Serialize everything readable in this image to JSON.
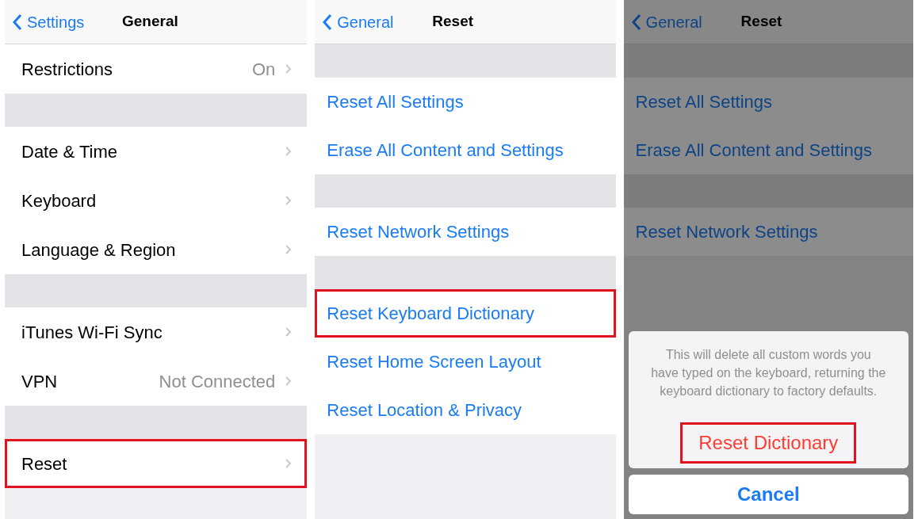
{
  "panels": [
    {
      "nav": {
        "back": "Settings",
        "title": "General"
      },
      "dimmed": false,
      "rows": [
        {
          "kind": "row",
          "label": "Restrictions",
          "value": "On",
          "chevron": true,
          "highlighted": false
        },
        {
          "kind": "spacer"
        },
        {
          "kind": "row",
          "label": "Date & Time",
          "chevron": true,
          "highlighted": false
        },
        {
          "kind": "row",
          "label": "Keyboard",
          "chevron": true,
          "highlighted": false
        },
        {
          "kind": "row",
          "label": "Language & Region",
          "chevron": true,
          "highlighted": false
        },
        {
          "kind": "spacer"
        },
        {
          "kind": "row",
          "label": "iTunes Wi-Fi Sync",
          "chevron": true,
          "highlighted": false
        },
        {
          "kind": "row",
          "label": "VPN",
          "value": "Not Connected",
          "chevron": true,
          "highlighted": false
        },
        {
          "kind": "spacer"
        },
        {
          "kind": "row",
          "label": "Reset",
          "chevron": true,
          "highlighted": true
        }
      ]
    },
    {
      "nav": {
        "back": "General",
        "title": "Reset"
      },
      "dimmed": false,
      "rows": [
        {
          "kind": "spacer"
        },
        {
          "kind": "action",
          "label": "Reset All Settings",
          "highlighted": false
        },
        {
          "kind": "action",
          "label": "Erase All Content and Settings",
          "highlighted": false
        },
        {
          "kind": "spacer"
        },
        {
          "kind": "action",
          "label": "Reset Network Settings",
          "highlighted": false
        },
        {
          "kind": "spacer"
        },
        {
          "kind": "action",
          "label": "Reset Keyboard Dictionary",
          "highlighted": true
        },
        {
          "kind": "action",
          "label": "Reset Home Screen Layout",
          "highlighted": false
        },
        {
          "kind": "action",
          "label": "Reset Location & Privacy",
          "highlighted": false
        }
      ]
    },
    {
      "nav": {
        "back": "General",
        "title": "Reset"
      },
      "dimmed": true,
      "rows": [
        {
          "kind": "spacer"
        },
        {
          "kind": "action",
          "label": "Reset All Settings",
          "highlighted": false
        },
        {
          "kind": "action",
          "label": "Erase All Content and Settings",
          "highlighted": false
        },
        {
          "kind": "spacer"
        },
        {
          "kind": "action",
          "label": "Reset Network Settings",
          "highlighted": false
        }
      ],
      "action_sheet": {
        "message": "This will delete all custom words you have typed on the keyboard, returning the keyboard dictionary to factory defaults.",
        "destructive": {
          "label": "Reset Dictionary",
          "highlighted": true
        },
        "cancel": "Cancel"
      }
    }
  ]
}
